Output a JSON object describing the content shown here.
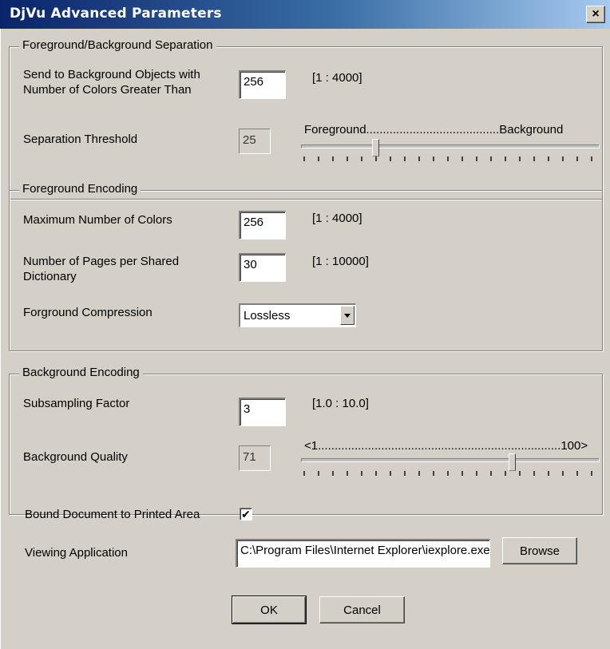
{
  "window": {
    "title": "DjVu Advanced Parameters",
    "close_glyph": "×"
  },
  "separation": {
    "legend": "Foreground/Background Separation",
    "send_label_line1": "Send to Background Objects with",
    "send_label_line2": "Number of Colors Greater Than",
    "send_value": "256",
    "send_range": "[1 : 4000]",
    "threshold_label": "Separation Threshold",
    "threshold_value": "25",
    "slider_caption": "Foreground........................................Background",
    "slider_level_fraction": 0.25
  },
  "foreground": {
    "legend": "Foreground Encoding",
    "max_colors_label": "Maximum Number of Colors",
    "max_colors_value": "256",
    "max_colors_range": "[1 : 4000]",
    "pages_label_line1": "Number of Pages per Shared",
    "pages_label_line2": "Dictionary",
    "pages_value": "30",
    "pages_range": "[1 : 10000]",
    "compression_label": "Forground Compression",
    "compression_value": "Lossless"
  },
  "background": {
    "legend": "Background Encoding",
    "subsampling_label": "Subsampling Factor",
    "subsampling_value": "3",
    "subsampling_range": "[1.0 : 10.0]",
    "quality_label": "Background  Quality",
    "quality_value": "71",
    "slider_caption": "<1.........................................................................100>",
    "slider_level_fraction": 0.71
  },
  "bound": {
    "label": "Bound Document to Printed Area",
    "checked_glyph": "✔"
  },
  "viewer": {
    "label": "Viewing Application",
    "value": "C:\\Program Files\\Internet Explorer\\iexplore.exe",
    "browse_label": "Browse"
  },
  "buttons": {
    "ok_label": "OK",
    "cancel_label": "Cancel"
  }
}
